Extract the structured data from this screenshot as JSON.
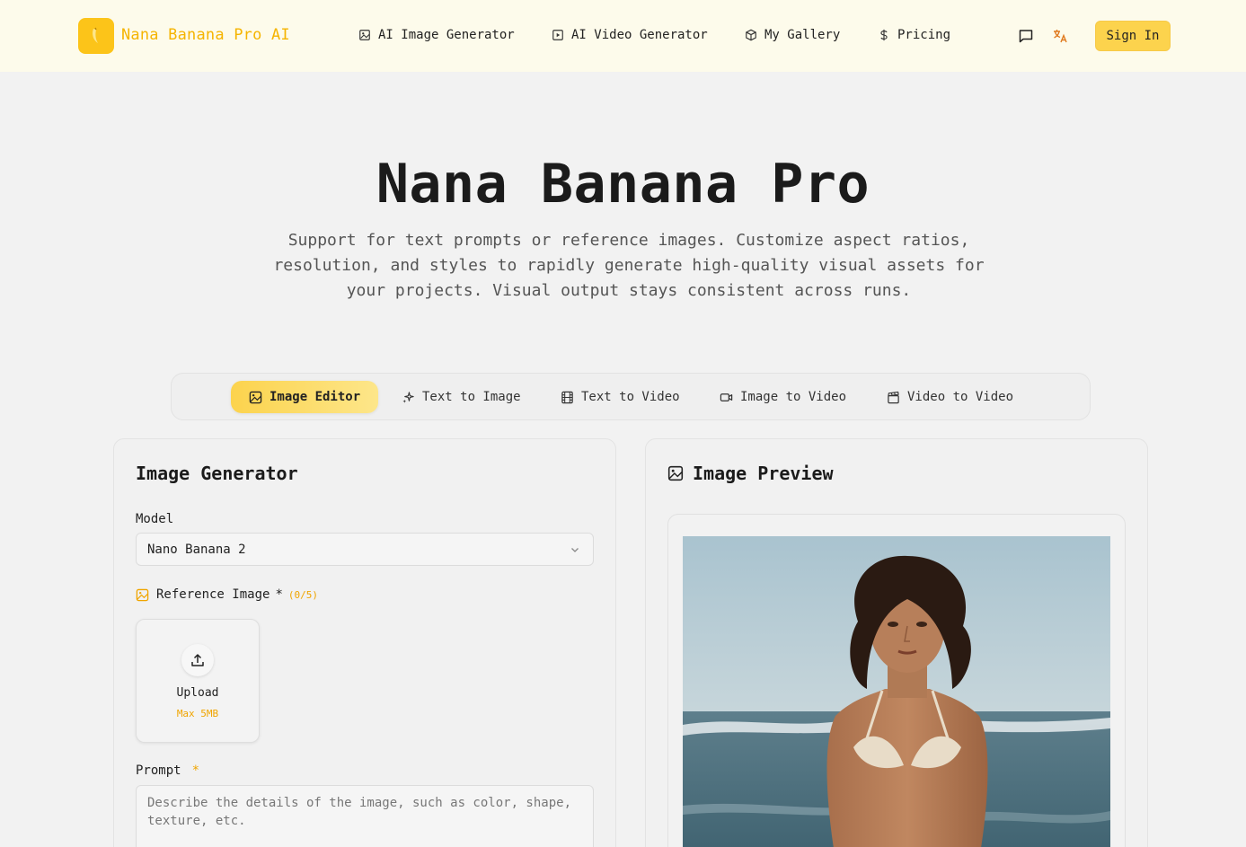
{
  "header": {
    "logo_text": "Nana Banana Pro AI",
    "nav": [
      {
        "label": "AI Image Generator",
        "icon": "image-icon"
      },
      {
        "label": "AI Video Generator",
        "icon": "video-icon"
      },
      {
        "label": "My Gallery",
        "icon": "box-icon"
      },
      {
        "label": "Pricing",
        "icon": "dollar-icon"
      }
    ],
    "sign_in": "Sign In"
  },
  "hero": {
    "title": "Nana Banana Pro",
    "subtitle": "Support for text prompts or reference images. Customize aspect ratios, resolution, and styles to rapidly generate high-quality visual assets for your projects. Visual output stays consistent across runs."
  },
  "tabs": [
    {
      "label": "Image Editor",
      "active": true
    },
    {
      "label": "Text to Image",
      "active": false
    },
    {
      "label": "Text to Video",
      "active": false
    },
    {
      "label": "Image to Video",
      "active": false
    },
    {
      "label": "Video to Video",
      "active": false
    }
  ],
  "generator": {
    "title": "Image Generator",
    "model_label": "Model",
    "model_value": "Nano Banana 2",
    "reference_label": "Reference Image",
    "reference_required": "*",
    "reference_count": "(0/5)",
    "upload_label": "Upload",
    "upload_max": "Max 5MB",
    "prompt_label": "Prompt",
    "prompt_required": "*",
    "prompt_placeholder": "Describe the details of the image, such as color, shape, texture, etc."
  },
  "preview": {
    "title": "Image Preview"
  },
  "colors": {
    "accent": "#fcc419",
    "header_bg": "#fdfbeb",
    "page_bg": "#f2f2f2"
  }
}
